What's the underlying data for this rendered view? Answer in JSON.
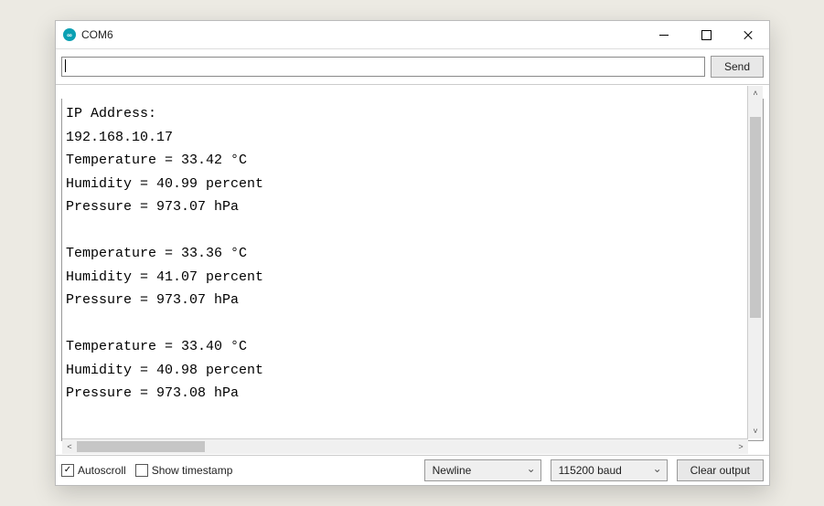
{
  "window": {
    "title": "COM6",
    "icon_glyph": "∞"
  },
  "toolbar": {
    "input_value": "",
    "send_label": "Send"
  },
  "console": {
    "lines": [
      "IP Address:",
      "192.168.10.17",
      "Temperature = 33.42 °C",
      "Humidity = 40.99 percent",
      "Pressure = 973.07 hPa",
      "",
      "Temperature = 33.36 °C",
      "Humidity = 41.07 percent",
      "Pressure = 973.07 hPa",
      "",
      "Temperature = 33.40 °C",
      "Humidity = 40.98 percent",
      "Pressure = 973.08 hPa"
    ]
  },
  "statusbar": {
    "autoscroll": {
      "label": "Autoscroll",
      "checked": true
    },
    "show_timestamp": {
      "label": "Show timestamp",
      "checked": false
    },
    "line_ending": {
      "selected": "Newline"
    },
    "baud": {
      "selected": "115200 baud"
    },
    "clear_label": "Clear output"
  }
}
